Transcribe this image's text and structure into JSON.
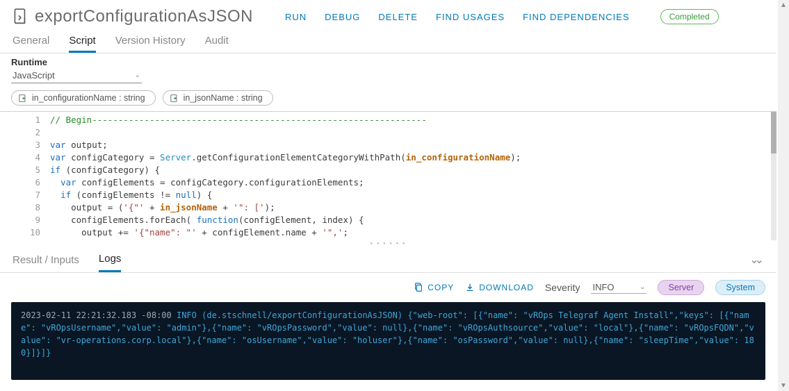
{
  "header": {
    "title": "exportConfigurationAsJSON",
    "actions": {
      "run": "RUN",
      "debug": "DEBUG",
      "delete": "DELETE",
      "find_usages": "FIND USAGES",
      "find_deps": "FIND DEPENDENCIES"
    },
    "status": "Completed"
  },
  "tabs": {
    "general": "General",
    "script": "Script",
    "version": "Version History",
    "audit": "Audit"
  },
  "runtime": {
    "label": "Runtime",
    "value": "JavaScript"
  },
  "params": [
    {
      "name": "in_configurationName : string"
    },
    {
      "name": "in_jsonName : string"
    }
  ],
  "editor": {
    "lines": [
      "1",
      "2",
      "3",
      "4",
      "5",
      "6",
      "7",
      "8",
      "9",
      "10"
    ],
    "code_html": "<span class=\"c-comment\">// Begin----------------------------------------------------------------</span>\n\n<span class=\"c-key\">var</span> output;\n<span class=\"c-key\">var</span> configCategory = <span class=\"c-type\">Server</span>.getConfigurationElementCategoryWithPath(<span class=\"c-par\">in_configurationName</span>);\n<span class=\"c-key\">if</span> (configCategory) {\n  <span class=\"c-key\">var</span> configElements = configCategory.configurationElements;\n  <span class=\"c-key\">if</span> (configElements != <span class=\"c-key\">null</span>) {\n    output = (<span class=\"c-str\">'{\"'</span> + <span class=\"c-par\">in_jsonName</span> + <span class=\"c-str\">'\": ['</span>);\n    configElements.forEach( <span class=\"c-key\">function</span>(configElement, index) {\n      output += <span class=\"c-str\">'{\"name\": \"'</span> + configElement.name + <span class=\"c-str\">'\",'</span>;"
  },
  "lower": {
    "tabs": {
      "result": "Result / Inputs",
      "logs": "Logs"
    },
    "toolbar": {
      "copy": "COPY",
      "download": "DOWNLOAD",
      "sev_label": "Severity",
      "sev_value": "INFO",
      "server": "Server",
      "system": "System"
    },
    "log": {
      "ts": "2023-02-11 22:21:32.183 -08:00",
      "level": "INFO",
      "body": "(de.stschnell/exportConfigurationAsJSON) {\"web-root\": [{\"name\": \"vROps Telegraf Agent Install\",\"keys\": [{\"name\": \"vROpsUsername\",\"value\": \"admin\"},{\"name\": \"vROpsPassword\",\"value\": null},{\"name\": \"vROpsAuthsource\",\"value\": \"local\"},{\"name\": \"vROpsFQDN\",\"value\": \"vr-operations.corp.local\"},{\"name\": \"osUsername\",\"value\": \"holuser\"},{\"name\": \"osPassword\",\"value\": null},{\"name\": \"sleepTime\",\"value\": 180}]}]}"
    }
  }
}
